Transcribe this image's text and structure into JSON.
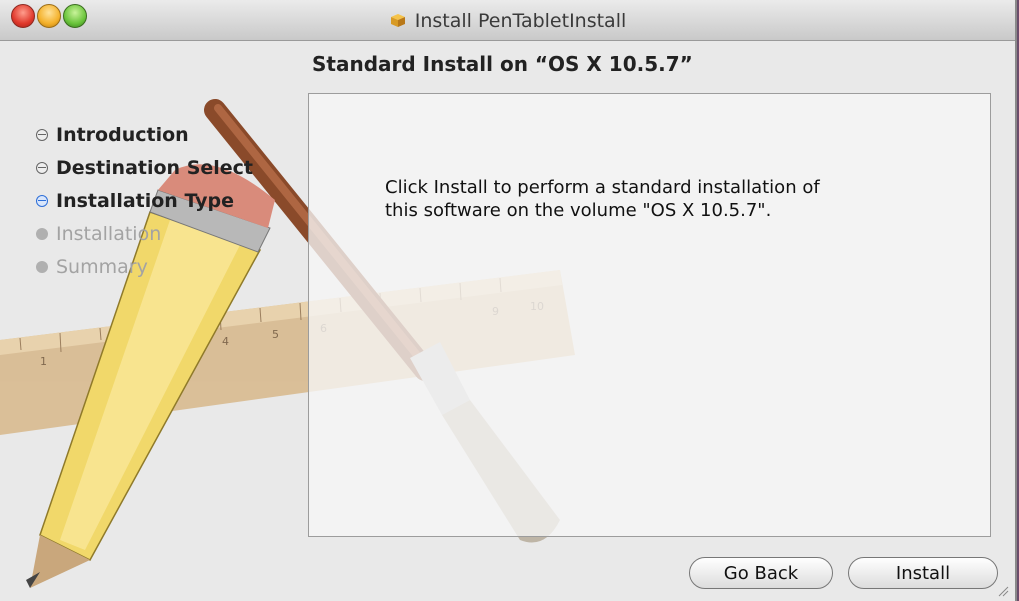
{
  "window": {
    "title": "Install PenTabletInstall",
    "title_icon": "package-icon"
  },
  "heading": "Standard Install on “OS X 10.5.7”",
  "steps": [
    {
      "label": "Introduction",
      "state": "done"
    },
    {
      "label": "Destination Select",
      "state": "done"
    },
    {
      "label": "Installation Type",
      "state": "current"
    },
    {
      "label": "Installation",
      "state": "pending"
    },
    {
      "label": "Summary",
      "state": "pending"
    }
  ],
  "content": {
    "line1": "Click Install to perform a standard installation of",
    "line2": "this software on the volume \"OS X 10.5.7\"."
  },
  "buttons": {
    "go_back": "Go Back",
    "install": "Install"
  },
  "ruler_ticks": [
    "1",
    "4",
    "5",
    "6",
    "9",
    "10"
  ],
  "colors": {
    "accent": "#2e6fd8",
    "close": "#e0392c",
    "minimize": "#f4b12b",
    "zoom": "#6ac43b",
    "desktop": "#6b4d6b"
  }
}
